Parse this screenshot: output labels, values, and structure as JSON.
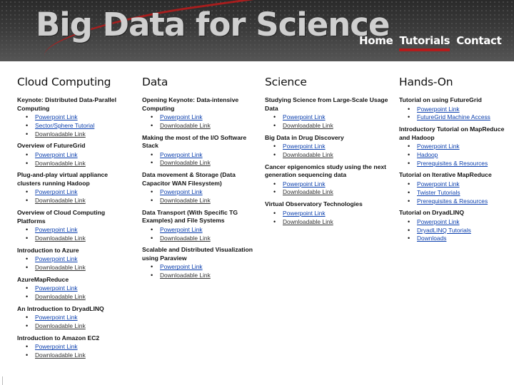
{
  "header": {
    "site_title": "Big Data for Science",
    "nav": [
      {
        "label": "Home",
        "active": false
      },
      {
        "label": "Tutorials",
        "active": true
      },
      {
        "label": "Contact",
        "active": false
      }
    ],
    "accent_color": "#b51c1c"
  },
  "columns": [
    {
      "title": "Cloud Computing",
      "sections": [
        {
          "title": "Keynote: Distributed Data-Parallel Computing",
          "links": [
            {
              "label": "Powerpoint Link",
              "link": true
            },
            {
              "label": "Sector/Sphere Tutorial",
              "link": true
            },
            {
              "label": "Downloadable Link",
              "link": false
            }
          ]
        },
        {
          "title": "Overview of FutureGrid",
          "links": [
            {
              "label": "Powerpoint Link",
              "link": true
            },
            {
              "label": "Downloadable Link",
              "link": false
            }
          ]
        },
        {
          "title": "Plug-and-play virtual appliance clusters running Hadoop",
          "links": [
            {
              "label": "Powerpoint Link",
              "link": true
            },
            {
              "label": "Downloadable Link",
              "link": false
            }
          ]
        },
        {
          "title": "Overview of Cloud Computing Platforms",
          "links": [
            {
              "label": "Powerpoint Link",
              "link": true
            },
            {
              "label": "Downloadable Link",
              "link": false
            }
          ]
        },
        {
          "title": "Introduction to Azure",
          "links": [
            {
              "label": "Powerpoint Link",
              "link": true
            },
            {
              "label": "Downloadable Link",
              "link": false
            }
          ]
        },
        {
          "title": "AzureMapReduce",
          "links": [
            {
              "label": "Powerpoint Link",
              "link": true
            },
            {
              "label": "Downloadable Link",
              "link": false
            }
          ]
        },
        {
          "title": "An Introduction to DryadLINQ",
          "links": [
            {
              "label": "Powerpoint Link",
              "link": true
            },
            {
              "label": "Downloadable Link",
              "link": false
            }
          ]
        },
        {
          "title": "Introduction to Amazon EC2",
          "links": [
            {
              "label": "Powerpoint Link",
              "link": true
            },
            {
              "label": "Downloadable Link",
              "link": false
            }
          ]
        }
      ]
    },
    {
      "title": "Data",
      "sections": [
        {
          "title": "Opening Keynote: Data-intensive Computing",
          "links": [
            {
              "label": "Powerpoint Link",
              "link": true
            },
            {
              "label": "Downloadable Link",
              "link": false
            }
          ]
        },
        {
          "title": "Making the most of the I/O Software Stack",
          "links": [
            {
              "label": "Powerpoint Link",
              "link": true
            },
            {
              "label": "Downloadable Link",
              "link": false
            }
          ]
        },
        {
          "title": "Data movement & Storage (Data Capacitor WAN Filesystem)",
          "links": [
            {
              "label": "Powerpoint Link",
              "link": true
            },
            {
              "label": "Downloadable Link",
              "link": false
            }
          ]
        },
        {
          "title": "Data Transport (With Specific TG Examples) and File Systems",
          "links": [
            {
              "label": "Powerpoint Link",
              "link": true
            },
            {
              "label": "Downloadable Link",
              "link": false
            }
          ]
        },
        {
          "title": "Scalable and Distributed Visualization using Paraview",
          "links": [
            {
              "label": "Powerpoint Link",
              "link": true
            },
            {
              "label": "Downloadable Link",
              "link": false
            }
          ]
        }
      ]
    },
    {
      "title": "Science",
      "sections": [
        {
          "title": "Studying Science from Large-Scale Usage Data",
          "links": [
            {
              "label": "Powerpoint Link",
              "link": true
            },
            {
              "label": "Downloadable Link",
              "link": false
            }
          ]
        },
        {
          "title": "Big Data in Drug Discovery",
          "links": [
            {
              "label": "Powerpoint Link",
              "link": true
            },
            {
              "label": "Downloadable Link",
              "link": false
            }
          ]
        },
        {
          "title": "Cancer epigenomics study using the next generation sequencing data",
          "links": [
            {
              "label": "Powerpoint Link",
              "link": true
            },
            {
              "label": "Downloadable Link",
              "link": false
            }
          ]
        },
        {
          "title": "Virtual Observatory Technologies",
          "links": [
            {
              "label": "Powerpoint Link",
              "link": true
            },
            {
              "label": "Downloadable Link",
              "link": false
            }
          ]
        }
      ]
    },
    {
      "title": "Hands-On",
      "sections": [
        {
          "title": "Tutorial on using FutureGrid",
          "links": [
            {
              "label": "Powerpoint Link",
              "link": true
            },
            {
              "label": "FutureGrid Machine Access",
              "link": true
            }
          ]
        },
        {
          "title": "Introductory Tutorial on MapReduce and Hadoop",
          "links": [
            {
              "label": "Powerpoint Link",
              "link": true
            },
            {
              "label": "Hadoop",
              "link": true
            },
            {
              "label": "Prerequisites & Resources",
              "link": true
            }
          ]
        },
        {
          "title": "Tutorial on Iterative MapReduce",
          "links": [
            {
              "label": "Powerpoint Link",
              "link": true
            },
            {
              "label": "Twister Tutorials",
              "link": true
            },
            {
              "label": "Prerequisites & Resources",
              "link": true
            }
          ]
        },
        {
          "title": "Tutorial on DryadLINQ",
          "links": [
            {
              "label": "Powerpoint Link",
              "link": true
            },
            {
              "label": "DryadLINQ Tutorials",
              "link": true
            },
            {
              "label": "Downloads",
              "link": true
            }
          ]
        }
      ]
    }
  ]
}
